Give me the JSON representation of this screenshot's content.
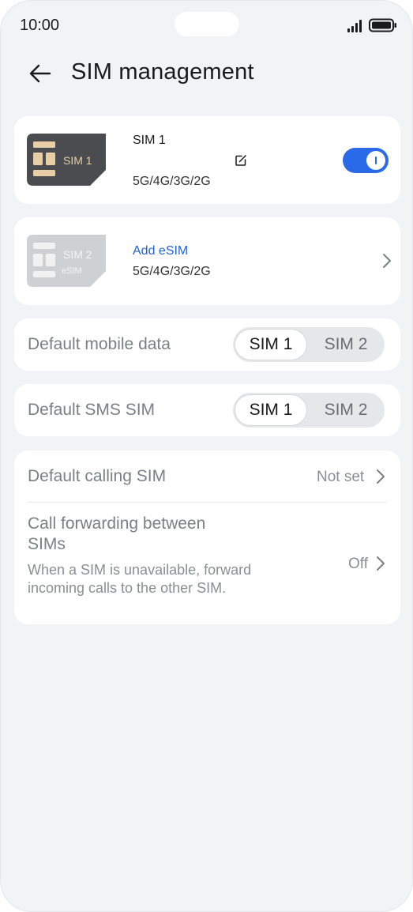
{
  "status_bar": {
    "time": "10:00",
    "icons": [
      "signal-icon",
      "battery-icon"
    ]
  },
  "header": {
    "title": "SIM management",
    "back_icon": "arrow-left-icon"
  },
  "sim1": {
    "card_label": "SIM 1",
    "title": "SIM 1",
    "networks": "5G/4G/3G/2G",
    "enabled": true,
    "edit_icon": "edit-icon"
  },
  "sim2": {
    "card_label": "SIM 2",
    "card_sublabel": "eSIM",
    "action": "Add eSIM",
    "networks": "5G/4G/3G/2G"
  },
  "default_mobile_data": {
    "label": "Default mobile data",
    "options": [
      "SIM 1",
      "SIM 2"
    ],
    "selected": "SIM 1"
  },
  "default_sms": {
    "label": "Default SMS SIM",
    "options": [
      "SIM 1",
      "SIM 2"
    ],
    "selected": "SIM 1"
  },
  "default_calling": {
    "label": "Default calling SIM",
    "value": "Not set"
  },
  "call_forwarding": {
    "label_line1": "Call forwarding between",
    "label_line2": "SIMs",
    "description": "When a SIM is unavailable, forward incoming calls to the other SIM.",
    "value": "Off"
  },
  "colors": {
    "accent": "#2a6ae8",
    "link": "#2364d2",
    "background": "#f1f3f5",
    "card": "#ffffff"
  }
}
